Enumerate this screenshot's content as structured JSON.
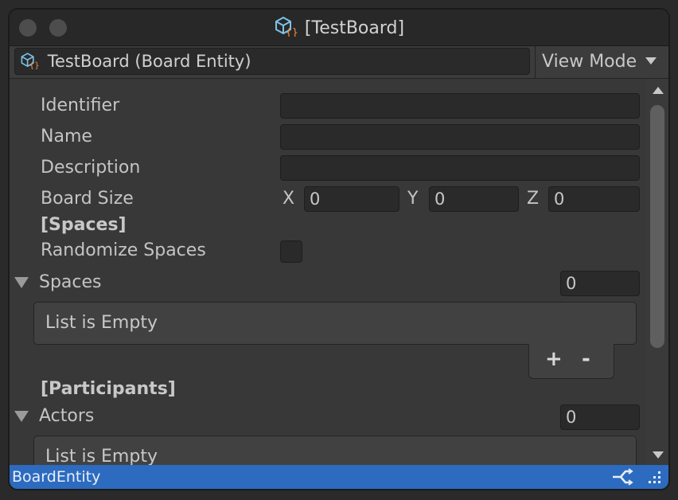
{
  "window": {
    "title": "[TestBoard]"
  },
  "header": {
    "object_label": "TestBoard (Board Entity)",
    "view_mode_label": "View Mode"
  },
  "fields": {
    "identifier": {
      "label": "Identifier",
      "value": ""
    },
    "name": {
      "label": "Name",
      "value": ""
    },
    "description": {
      "label": "Description",
      "value": ""
    },
    "board_size": {
      "label": "Board Size",
      "x_label": "X",
      "x_value": "0",
      "y_label": "Y",
      "y_value": "0",
      "z_label": "Z",
      "z_value": "0"
    }
  },
  "sections": {
    "spaces_header": "[Spaces]",
    "randomize_spaces_label": "Randomize Spaces",
    "randomize_spaces_checked": false,
    "spaces_label": "Spaces",
    "spaces_count": "0",
    "spaces_empty": "List is Empty",
    "add_label": "+",
    "remove_label": "-",
    "participants_header": "[Participants]",
    "actors_label": "Actors",
    "actors_count": "0",
    "actors_empty": "List is Empty"
  },
  "statusbar": {
    "text": "BoardEntity",
    "accent": "#2c6bbf"
  },
  "icons": [
    "script-cube-icon",
    "chevron-down-icon",
    "foldout-arrow-icon",
    "scroll-up-icon",
    "scroll-down-icon",
    "link-icon",
    "resize-grip-icon"
  ]
}
